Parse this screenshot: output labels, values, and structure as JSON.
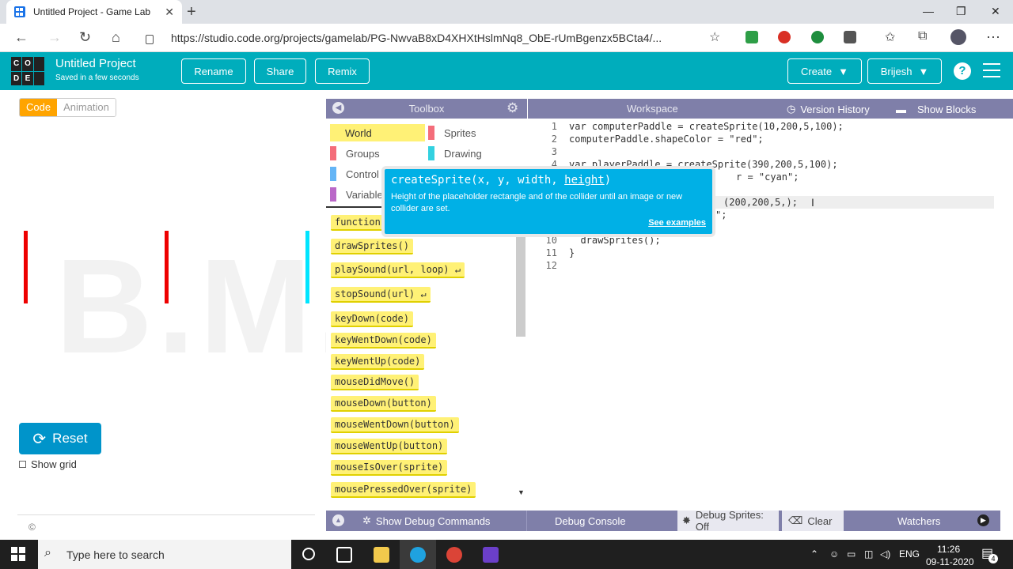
{
  "browser": {
    "tab_title": "Untitled Project - Game Lab",
    "url": "https://studio.code.org/projects/gamelab/PG-NwvaB8xD4XHXtHslmNq8_ObE-rUmBgenzx5BCta4/..."
  },
  "header": {
    "logo_letters": [
      "C",
      "O",
      "D",
      "D",
      "E",
      ""
    ],
    "logo": [
      "C",
      "O",
      "",
      "D",
      "E",
      ""
    ],
    "project_title": "Untitled Project",
    "saved_status": "Saved in a few seconds",
    "rename": "Rename",
    "share": "Share",
    "remix": "Remix",
    "create": "Create",
    "user": "Brijesh",
    "help": "?"
  },
  "left": {
    "mode_code": "Code",
    "mode_animation": "Animation",
    "watermark": "B.M.CODING",
    "reset": "Reset",
    "show_grid": "Show grid",
    "copyright": "©"
  },
  "toolbox": {
    "title": "Toolbox",
    "categories": [
      {
        "label": "World",
        "color": "#fff176"
      },
      {
        "label": "Sprites",
        "color": "#f46d7a"
      },
      {
        "label": "Groups",
        "color": "#f46d7a"
      },
      {
        "label": "Drawing",
        "color": "#33d1e0"
      },
      {
        "label": "Control",
        "color": "#64b5f6"
      },
      {
        "label": "Variables",
        "color": "#ba68c8"
      }
    ],
    "blocks": [
      "function",
      "drawSprites()",
      "playSound(url, loop) ↵",
      "stopSound(url) ↵",
      "keyDown(code)",
      "keyWentDown(code)",
      "keyWentUp(code)",
      "mouseDidMove()",
      "mouseDown(button)",
      "mouseWentDown(button)",
      "mouseWentUp(button)",
      "mouseIsOver(sprite)",
      "mousePressedOver(sprite)"
    ]
  },
  "workspace": {
    "title": "Workspace",
    "version_history": "Version History",
    "show_blocks": "Show Blocks",
    "line_numbers": [
      "1",
      "2",
      "3",
      "4",
      "5",
      "6",
      "7",
      "8",
      "9",
      "10",
      "11",
      "12"
    ],
    "lines": {
      "l1": "var computerPaddle = createSprite(10,200,5,100);",
      "l2": "computerPaddle.shapeColor = \"red\";",
      "l4": "var playerPaddle = createSprite(390,200,5,100);",
      "l5_tail": "r = \"cyan\";",
      "l7_tail": "(200,200,5,);",
      "l8_tail": "\";",
      "l10": "  drawSprites();",
      "l11": "}"
    }
  },
  "tooltip": {
    "sig_pre": "createSprite(x, y, width, ",
    "sig_param": "height",
    "sig_post": ")",
    "description": "Height of the placeholder rectangle and of the collider until an image or new collider are set.",
    "link": "See examples"
  },
  "debug": {
    "show_commands": "Show Debug Commands",
    "console": "Debug Console",
    "sprites": "Debug Sprites: Off",
    "clear": "Clear",
    "watchers": "Watchers"
  },
  "taskbar": {
    "search_placeholder": "Type here to search",
    "lang": "ENG",
    "time": "11:26",
    "date": "09-11-2020",
    "notifications": "4"
  }
}
